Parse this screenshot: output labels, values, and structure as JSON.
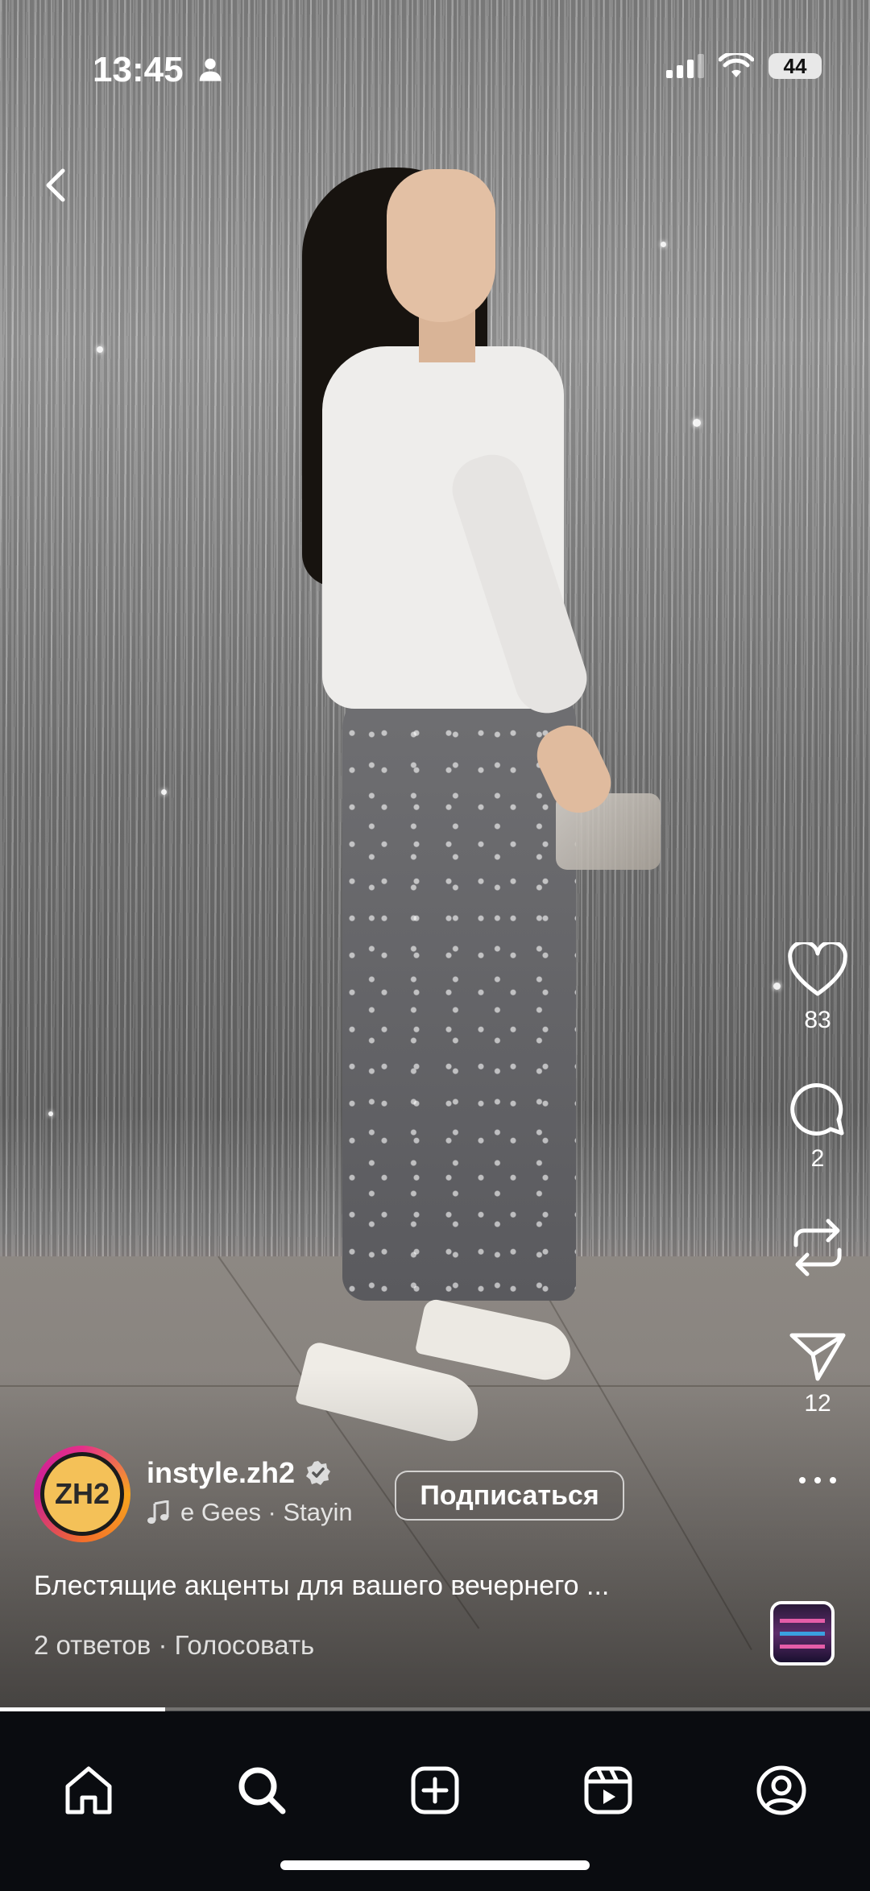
{
  "status_bar": {
    "time": "13:45",
    "battery": "44"
  },
  "post": {
    "username": "instyle.zh2",
    "avatar_text": "ZH2",
    "music_text": "e Gees · Stayin",
    "follow_label": "Подписаться",
    "caption": "Блестящие акценты для вашего вечернего ...",
    "replies": "2 ответов",
    "vote": "Голосовать",
    "separator": "·",
    "video_progress": 0.19
  },
  "actions": {
    "likes": "83",
    "comments": "2",
    "shares": "12"
  },
  "nav": [
    "home-icon",
    "search-icon",
    "create-icon",
    "reels-icon",
    "profile-icon"
  ]
}
